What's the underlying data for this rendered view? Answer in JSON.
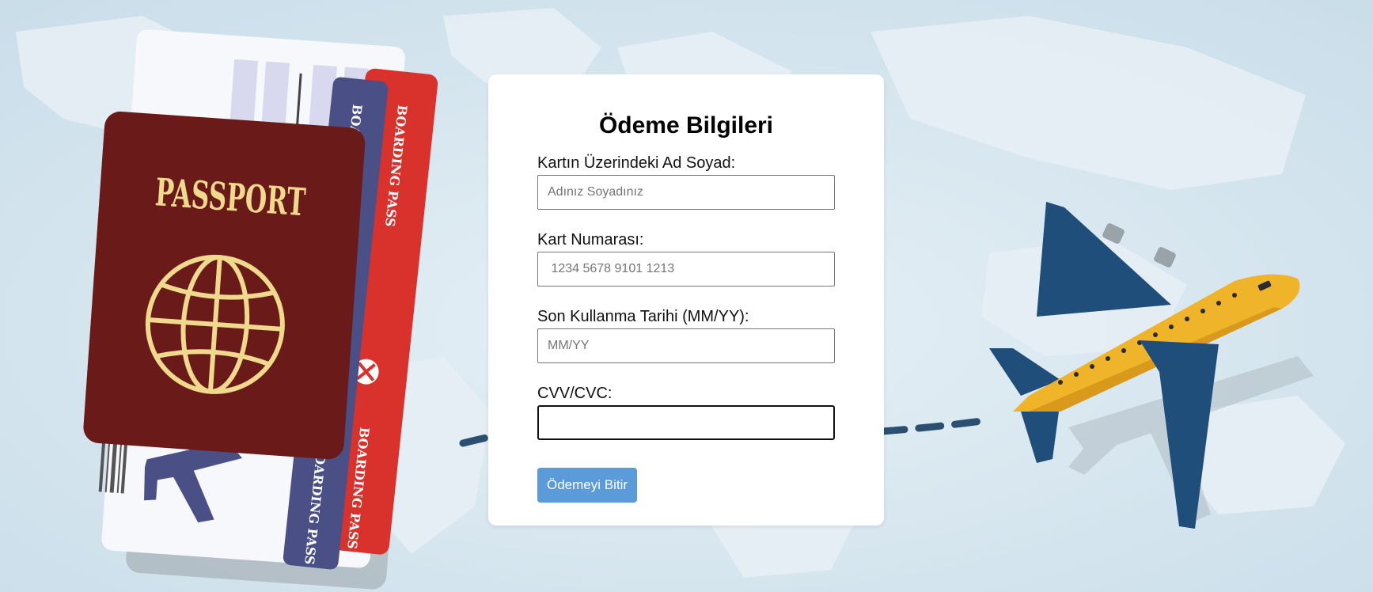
{
  "form": {
    "title": "Ödeme Bilgileri",
    "name_label": "Kartın Üzerindeki Ad Soyad:",
    "name_placeholder": "Adınız Soyadınız",
    "card_label": "Kart Numarası:",
    "card_placeholder": " 1234 5678 9101 1213",
    "expiry_label": "Son Kullanma Tarihi (MM/YY):",
    "expiry_placeholder": "MM/YY",
    "cvv_label": "CVV/CVC:",
    "cvv_placeholder": "",
    "submit_label": "Ödemeyi Bitir"
  },
  "background": {
    "passport_text": "PASSPORT",
    "ticket_text": "BOARDING PASS"
  },
  "colors": {
    "button": "#5b9bd9",
    "passport": "#6b1a1a",
    "plane_body": "#f0b42a",
    "plane_wing": "#1f4e7a",
    "ticket_red": "#d9312b",
    "ticket_navy": "#4a4f86"
  }
}
